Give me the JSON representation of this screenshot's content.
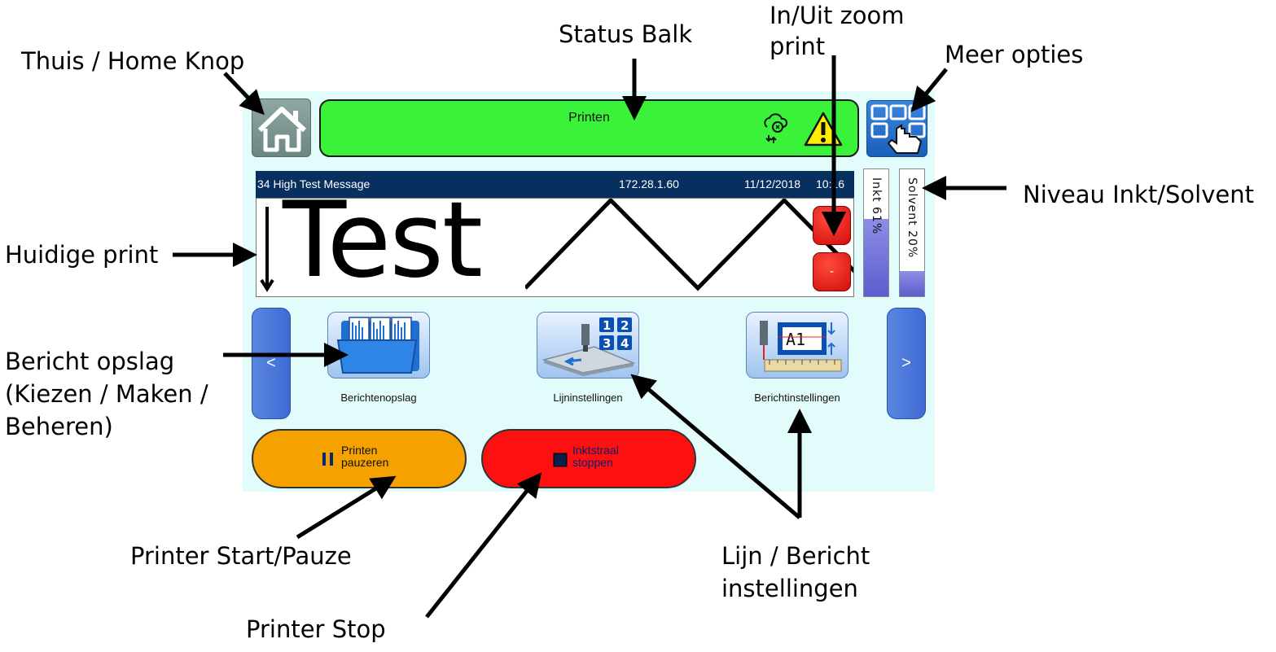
{
  "annotations": {
    "home": "Thuis / Home Knop",
    "status_bar": "Status Balk",
    "zoom_line1": "In/Uit zoom",
    "zoom_line2": "print",
    "more_options": "Meer opties",
    "ink_level": "Niveau Inkt/Solvent",
    "current_print": "Huidige print",
    "storage_line1": "Bericht opslag",
    "storage_line2": "(Kiezen / Maken /",
    "storage_line3": "Beheren)",
    "start_pause": "Printer Start/Pauze",
    "settings_line1": "Lijn / Bericht",
    "settings_line2": "instellingen",
    "stop": "Printer Stop"
  },
  "status": {
    "text": "Printen",
    "icons": [
      "cloud-sync-icon",
      "warning-icon"
    ]
  },
  "header": {
    "message_name": "34 High Test Message",
    "ip": "172.28.1.60",
    "date": "11/12/2018",
    "time": "10:16"
  },
  "preview": {
    "text": "Test"
  },
  "zoom": {
    "in_label": "+",
    "out_label": "-"
  },
  "levels": {
    "ink_label": "Inkt 61%",
    "ink_fraction": 0.61,
    "ink_color": "#6a6ad8",
    "solvent_label": "Solvent 20%",
    "solvent_fraction": 0.2
  },
  "nav": {
    "prev": "<",
    "next": ">"
  },
  "tiles": [
    {
      "label": "Berichtenopslag",
      "icon": "message-storage-icon"
    },
    {
      "label": "Lijninstellingen",
      "icon": "line-settings-icon"
    },
    {
      "label": "Berichtinstellingen",
      "icon": "message-settings-icon"
    }
  ],
  "actions": {
    "pause_line1": "Printen",
    "pause_line2": "pauzeren",
    "pause_color": "#f5a100",
    "stop_line1": "Inktstraal",
    "stop_line2": "stoppen",
    "stop_color": "#ff1010"
  },
  "colors": {
    "screen_bg": "#e2fbfb",
    "status_green": "#3bf23b",
    "header_navy": "#072f5f"
  }
}
